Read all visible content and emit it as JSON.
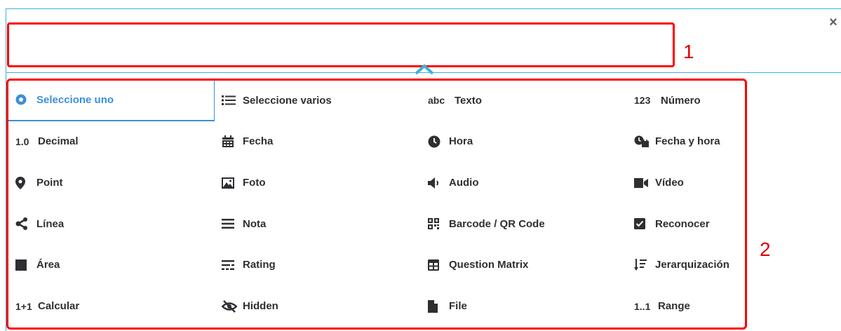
{
  "annotations": {
    "box1": "1",
    "box2": "2"
  },
  "close": {
    "symbol": "×"
  },
  "question_types": [
    {
      "label": "Seleccione uno",
      "icon": "radio-icon",
      "selected": true
    },
    {
      "label": "Seleccione varios",
      "icon": "list-icon"
    },
    {
      "label": "Texto",
      "icon": "abc-text-icon",
      "glyph": "abc"
    },
    {
      "label": "Número",
      "icon": "number-icon",
      "glyph": "123"
    },
    {
      "label": "Decimal",
      "icon": "decimal-icon",
      "glyph": "1.0"
    },
    {
      "label": "Fecha",
      "icon": "calendar-icon"
    },
    {
      "label": "Hora",
      "icon": "clock-icon"
    },
    {
      "label": "Fecha y hora",
      "icon": "datetime-icon"
    },
    {
      "label": "Point",
      "icon": "map-pin-icon"
    },
    {
      "label": "Foto",
      "icon": "photo-icon"
    },
    {
      "label": "Audio",
      "icon": "speaker-icon"
    },
    {
      "label": "Vídeo",
      "icon": "video-icon"
    },
    {
      "label": "Línea",
      "icon": "share-line-icon"
    },
    {
      "label": "Nota",
      "icon": "note-lines-icon"
    },
    {
      "label": "Barcode / QR Code",
      "icon": "qr-code-icon"
    },
    {
      "label": "Reconocer",
      "icon": "checkbox-icon"
    },
    {
      "label": "Área",
      "icon": "area-square-icon"
    },
    {
      "label": "Rating",
      "icon": "rating-icon"
    },
    {
      "label": "Question Matrix",
      "icon": "matrix-icon"
    },
    {
      "label": "Jerarquización",
      "icon": "ranking-icon"
    },
    {
      "label": "Calcular",
      "icon": "calculate-icon",
      "glyph": "1+1"
    },
    {
      "label": "Hidden",
      "icon": "hidden-eye-icon"
    },
    {
      "label": "File",
      "icon": "file-icon"
    },
    {
      "label": "Range",
      "icon": "range-icon",
      "glyph": "1..1"
    }
  ],
  "colors": {
    "accent": "#3b8fd9",
    "annotation": "#ff0000",
    "border": "#3bb3d9",
    "text": "#2d2f33"
  }
}
